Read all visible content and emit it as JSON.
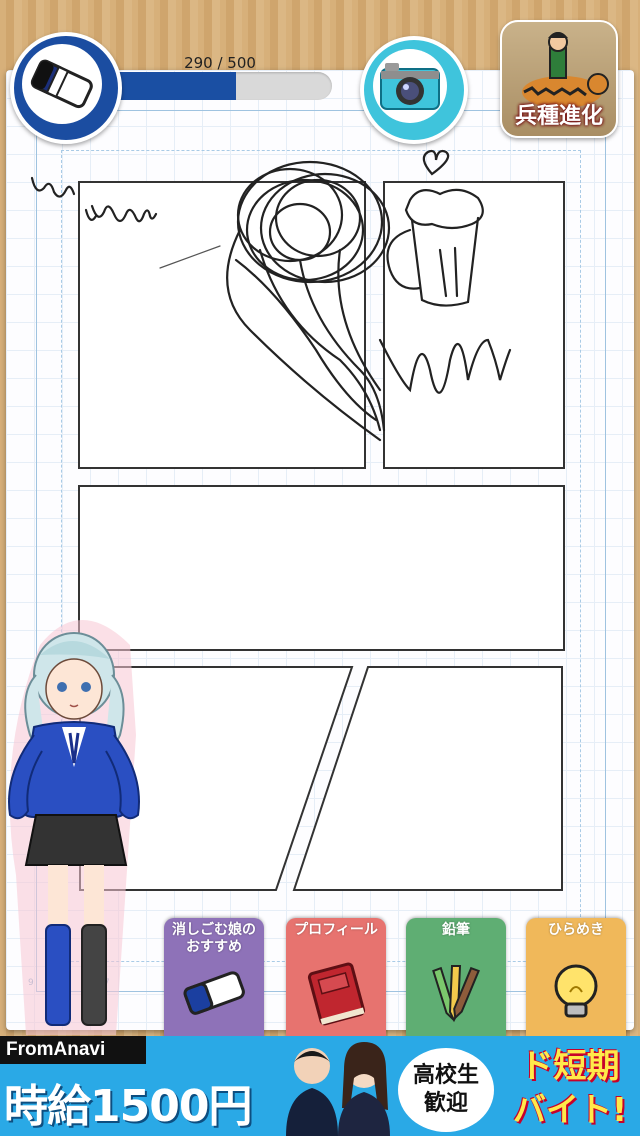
{
  "hud": {
    "hp_current": 290,
    "hp_max": 500,
    "hp_text": "290 / 500",
    "hp_fraction": 0.58,
    "eraser_icon": "eraser-icon",
    "camera_icon": "camera-icon"
  },
  "ad_icon": {
    "label": "兵種進化",
    "image": "tiger-rider-icon"
  },
  "tabs": [
    {
      "label": "消しごむ娘の\nおすすめ",
      "icon": "eraser-icon",
      "color": "#8e72b8"
    },
    {
      "label": "プロフィール",
      "icon": "book-icon",
      "color": "#e7736f"
    },
    {
      "label": "鉛筆",
      "icon": "pencils-icon",
      "color": "#5fae73"
    },
    {
      "label": "ひらめき",
      "icon": "lightbulb-icon",
      "color": "#f0b85a"
    }
  ],
  "banner": {
    "brand": "FromAnavi",
    "wage": "時給1500円",
    "bubble": "高校生\n歓迎",
    "promo": "ド短期\nバイト!"
  },
  "colors": {
    "eraser_blue": "#1b4da1",
    "camera_cyan": "#3fc4dc",
    "banner_blue": "#2aa9e6"
  }
}
